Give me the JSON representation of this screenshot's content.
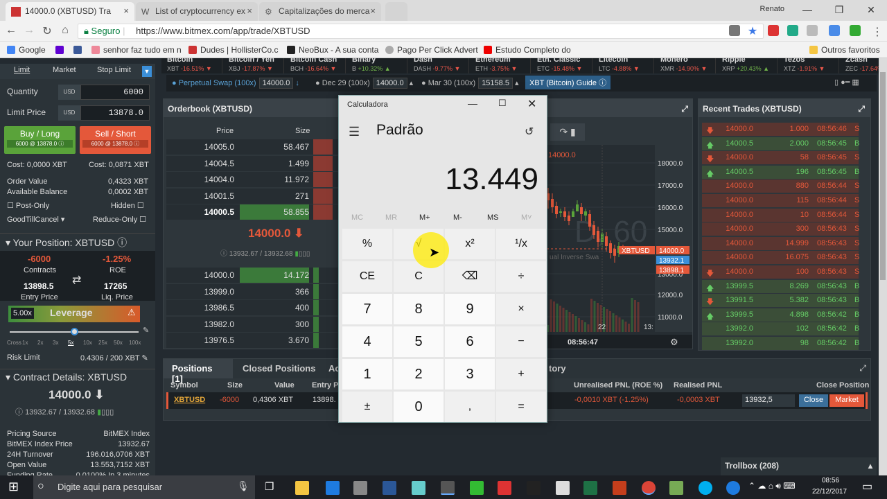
{
  "browser": {
    "tabs": [
      {
        "label": "14000.0 (XBTUSD) Tra"
      },
      {
        "label": "List of cryptocurrency ex"
      },
      {
        "label": "Capitalizações do merca"
      }
    ],
    "profile": "Renato",
    "secure_label": "Seguro",
    "url": "https://www.bitmex.com/app/trade/XBTUSD",
    "bookmarks": [
      "Google",
      "senhor faz tudo em n",
      "Dudes | HollisterCo.c",
      "NeoBux - A sua conta",
      "Pago Per Click Advert",
      "Estudo Completo do"
    ],
    "other_bookmarks": "Outros favoritos"
  },
  "tickers": [
    {
      "name": "Bitcoin",
      "sym": "XBT",
      "chg": "-16.51%",
      "up": false
    },
    {
      "name": "Bitcoin / Yen",
      "sym": "XBJ",
      "chg": "-17.87%",
      "up": false
    },
    {
      "name": "Bitcoin Cash",
      "sym": "BCH",
      "chg": "-16.64%",
      "up": false
    },
    {
      "name": "Binary",
      "sym": "B",
      "chg": "+10.32%",
      "up": true
    },
    {
      "name": "Dash",
      "sym": "DASH",
      "chg": "-9.77%",
      "up": false
    },
    {
      "name": "Ethereum",
      "sym": "ETH",
      "chg": "-3.75%",
      "up": false
    },
    {
      "name": "Eth. Classic",
      "sym": "ETC",
      "chg": "-15.48%",
      "up": false
    },
    {
      "name": "Litecoin",
      "sym": "LTC",
      "chg": "-4.88%",
      "up": false
    },
    {
      "name": "Monero",
      "sym": "XMR",
      "chg": "-14.90%",
      "up": false
    },
    {
      "name": "Ripple",
      "sym": "XRP",
      "chg": "+20.43%",
      "up": true
    },
    {
      "name": "Tezos",
      "sym": "XTZ",
      "chg": "-1.91%",
      "up": false
    },
    {
      "name": "Zcash",
      "sym": "ZEC",
      "chg": "-17.64%",
      "up": false
    }
  ],
  "contracts": {
    "perp": "Perpetual Swap (100x)",
    "perp_val": "14000.0",
    "dec": "Dec 29 (100x)",
    "dec_val": "14000.0",
    "mar": "Mar 30 (100x)",
    "mar_val": "15158.5",
    "guide": "XBT (Bitcoin) Guide"
  },
  "order": {
    "types": [
      "Limit",
      "Market",
      "Stop Limit"
    ],
    "quantity_label": "Quantity",
    "quantity": "6000",
    "usd": "USD",
    "limit_label": "Limit Price",
    "limit": "13878.0",
    "buy": "Buy / Long",
    "buy_sub": "6000 @ 13878.0",
    "sell": "Sell / Short",
    "sell_sub": "6000 @ 13878.0",
    "cost_buy": "Cost: 0,0000 XBT",
    "cost_sell": "Cost: 0,0871 XBT",
    "order_value_label": "Order Value",
    "order_value": "0,4323 XBT",
    "avail_label": "Available Balance",
    "avail": "0,0002 XBT",
    "post_only": "Post-Only",
    "hidden": "Hidden",
    "gtc": "GoodTillCancel",
    "reduce": "Reduce-Only"
  },
  "position": {
    "title": "Your Position: XBTUSD",
    "contracts": "-6000",
    "contracts_label": "Contracts",
    "roe": "-1.25%",
    "roe_label": "ROE",
    "entry": "13898.5",
    "entry_label": "Entry Price",
    "liq": "17265",
    "liq_label": "Liq. Price",
    "leverage_val": "5.00x",
    "leverage_label": "Leverage",
    "lev_ticks": [
      "Cross",
      "1x",
      "2x",
      "3x",
      "5x",
      "10x",
      "25x",
      "50x",
      "100x"
    ],
    "risk_label": "Risk Limit",
    "risk": "0.4306 / 200 XBT"
  },
  "contract_details": {
    "title": "Contract Details: XBTUSD",
    "price": "14000.0",
    "sub": "13932.67 / 13932.68",
    "rows": [
      [
        "Pricing Source",
        "BitMEX Index"
      ],
      [
        "BitMEX Index Price",
        "13932.67"
      ],
      [
        "24H Turnover",
        "196.016,0706 XBT"
      ],
      [
        "Open Value",
        "13.553,7152 XBT"
      ],
      [
        "Funding Rate",
        "0.0100% In 3 minutes"
      ]
    ]
  },
  "orderbook": {
    "title": "Orderbook (XBTUSD)",
    "price_h": "Price",
    "size_h": "Size",
    "asks": [
      [
        "14005.0",
        "58.467"
      ],
      [
        "14004.5",
        "1.499"
      ],
      [
        "14004.0",
        "11.972"
      ],
      [
        "14001.5",
        "271"
      ],
      [
        "14000.5",
        "58.855"
      ]
    ],
    "last": "14000.0",
    "mark": "13932.67 / 13932.68",
    "bids": [
      [
        "14000.0",
        "14.172"
      ],
      [
        "13999.0",
        "366"
      ],
      [
        "13986.5",
        "400"
      ],
      [
        "13982.0",
        "300"
      ],
      [
        "13976.5",
        "3.670"
      ]
    ]
  },
  "chart": {
    "price_top": "14000.0",
    "watermark": "D, 60",
    "axis": [
      "18000.0",
      "17000.0",
      "16000.0",
      "15000.0",
      "14000.0",
      "13000.0",
      "12000.0",
      "11000.0"
    ],
    "tag_sym": "XBTUSD",
    "tag_a": "13932.1",
    "tag_b": "13898.1",
    "tag_last": "14000.0",
    "date": "22",
    "date2": "13:",
    "time": "08:56:47",
    "sub_label": "ual Inverse Swa"
  },
  "trades": {
    "title": "Recent Trades (XBTUSD)",
    "rows": [
      [
        "14000.0",
        "1.000",
        "08:56:46",
        "S",
        "down"
      ],
      [
        "14000.5",
        "2.000",
        "08:56:45",
        "B",
        "up"
      ],
      [
        "14000.0",
        "58",
        "08:56:45",
        "S",
        "down"
      ],
      [
        "14000.5",
        "196",
        "08:56:45",
        "B",
        "up"
      ],
      [
        "14000.0",
        "880",
        "08:56:44",
        "S",
        ""
      ],
      [
        "14000.0",
        "115",
        "08:56:44",
        "S",
        ""
      ],
      [
        "14000.0",
        "10",
        "08:56:44",
        "S",
        ""
      ],
      [
        "14000.0",
        "300",
        "08:56:43",
        "S",
        ""
      ],
      [
        "14000.0",
        "14.999",
        "08:56:43",
        "S",
        ""
      ],
      [
        "14000.0",
        "16.075",
        "08:56:43",
        "S",
        ""
      ],
      [
        "14000.0",
        "100",
        "08:56:43",
        "S",
        "down"
      ],
      [
        "13999.5",
        "8.269",
        "08:56:43",
        "B",
        "up"
      ],
      [
        "13991.5",
        "5.382",
        "08:56:43",
        "B",
        "down"
      ],
      [
        "13999.5",
        "4.898",
        "08:56:42",
        "B",
        "up"
      ],
      [
        "13992.0",
        "102",
        "08:56:42",
        "B",
        ""
      ],
      [
        "13992.0",
        "98",
        "08:56:42",
        "B",
        ""
      ]
    ]
  },
  "positions": {
    "tabs": [
      "Positions [1]",
      "Closed Positions",
      "Ac",
      "tory"
    ],
    "cols": [
      "Symbol",
      "Size",
      "Value",
      "Entry Pr",
      "Unrealised PNL (ROE %)",
      "Realised PNL",
      "Close Position"
    ],
    "row": {
      "sym": "XBTUSD",
      "size": "-6000",
      "value": "0,4306 XBT",
      "entry": "13898.",
      "upnl": "-0,0010 XBT (-1.25%)",
      "rpnl": "-0,0003 XBT",
      "close_px": "13932,5",
      "close": "Close",
      "market": "Market"
    }
  },
  "trollbox": "Trollbox (208)",
  "calculator": {
    "title": "Calculadora",
    "mode": "Padrão",
    "display": "13.449",
    "mem": [
      "MC",
      "MR",
      "M+",
      "M-",
      "MS",
      "M˅"
    ],
    "keys": [
      "%",
      "√",
      "x²",
      "¹/x",
      "CE",
      "C",
      "⌫",
      "÷",
      "7",
      "8",
      "9",
      "×",
      "4",
      "5",
      "6",
      "−",
      "1",
      "2",
      "3",
      "+",
      "±",
      "0",
      ",",
      "="
    ]
  },
  "taskbar": {
    "search": "Digite aqui para pesquisar",
    "time": "08:56",
    "date": "22/12/2017"
  }
}
